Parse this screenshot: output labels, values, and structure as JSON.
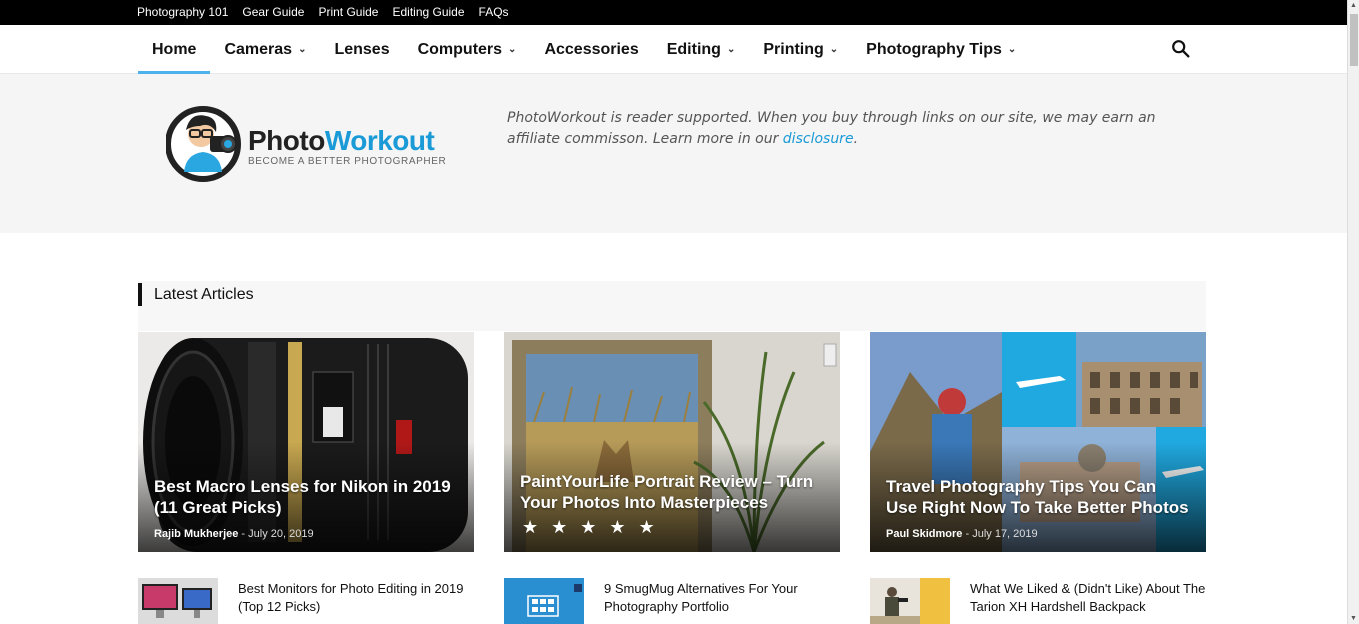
{
  "topbar": {
    "links": [
      "Photography 101",
      "Gear Guide",
      "Print Guide",
      "Editing Guide",
      "FAQs"
    ]
  },
  "nav": {
    "items": [
      {
        "label": "Home",
        "dropdown": false,
        "active": true
      },
      {
        "label": "Cameras",
        "dropdown": true
      },
      {
        "label": "Lenses",
        "dropdown": false
      },
      {
        "label": "Computers",
        "dropdown": true
      },
      {
        "label": "Accessories",
        "dropdown": false
      },
      {
        "label": "Editing",
        "dropdown": true
      },
      {
        "label": "Printing",
        "dropdown": true
      },
      {
        "label": "Photography Tips",
        "dropdown": true
      }
    ],
    "search_icon": "search-icon"
  },
  "header": {
    "logo_part1": "Photo",
    "logo_part2": "Workout",
    "logo_tagline": "BECOME A BETTER PHOTOGRAPHER",
    "disclaimer_text": "PhotoWorkout is reader supported. When you buy through links on our site, we may earn an affiliate commisson. Learn more in our ",
    "disclaimer_link": "disclosure",
    "disclaimer_end": "."
  },
  "latest": {
    "title": "Latest Articles",
    "featured": [
      {
        "title": "Best Macro Lenses for Nikon in 2019 (11 Great Picks)",
        "author": "Rajib Mukherjee",
        "date": "July 20, 2019"
      },
      {
        "title": "PaintYourLife Portrait Review – Turn Your Photos Into Masterpieces",
        "rating": "★ ★ ★ ★ ★"
      },
      {
        "title": "Travel Photography Tips You Can Use Right Now To Take Better Photos",
        "author": "Paul Skidmore",
        "date": "July 17, 2019"
      }
    ],
    "list": [
      {
        "title": "Best Monitors for Photo Editing in 2019 (Top 12 Picks)"
      },
      {
        "title": "9 SmugMug Alternatives For Your Photography Portfolio"
      },
      {
        "title": "What We Liked & (Didn't Like) About The Tarion XH Hardshell Backpack"
      }
    ],
    "watermark": "Travel Photography Tips"
  },
  "colors": {
    "accent": "#4db2ec",
    "link": "#1a9ad6",
    "topbar": "#000000"
  }
}
